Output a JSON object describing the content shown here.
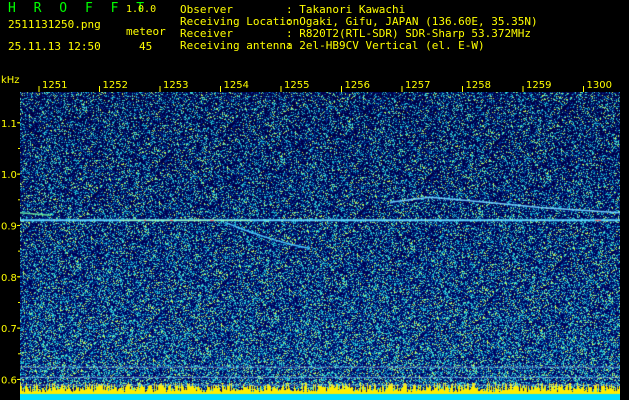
{
  "app": {
    "title": "H R O F F T",
    "version": "1.0.0"
  },
  "capture": {
    "filename": "2511131250.png",
    "datetime": "25.11.13 12:50",
    "mode": "meteor",
    "count": "45"
  },
  "info": [
    {
      "label": "Observer",
      "value": ": Takanori Kawachi"
    },
    {
      "label": "Receiving Location",
      "value": ": Ogaki, Gifu, JAPAN (136.60E, 35.35N)"
    },
    {
      "label": "Receiver",
      "value": ": R820T2(RTL-SDR) SDR-Sharp 53.372MHz"
    },
    {
      "label": "Receiving antenna",
      "value": ": 2el-HB9CV Vertical (el. E-W)"
    }
  ],
  "axis": {
    "unit": "kHz",
    "time_ticks": [
      "1251",
      "1252",
      "1253",
      "1254",
      "1255",
      "1256",
      "1257",
      "1258",
      "1259",
      "1300"
    ],
    "freq_ticks": [
      "1.1",
      "1.0",
      "0.9",
      "0.8",
      "0.7",
      "0.6"
    ],
    "freq_range": [
      0.56,
      1.16
    ]
  },
  "colors": {
    "label_text": "#ffff00",
    "title_green": "#00ff00",
    "background": "#000000",
    "spectrum_low": "#00004a",
    "spectrum_high": "#ffff00"
  }
}
